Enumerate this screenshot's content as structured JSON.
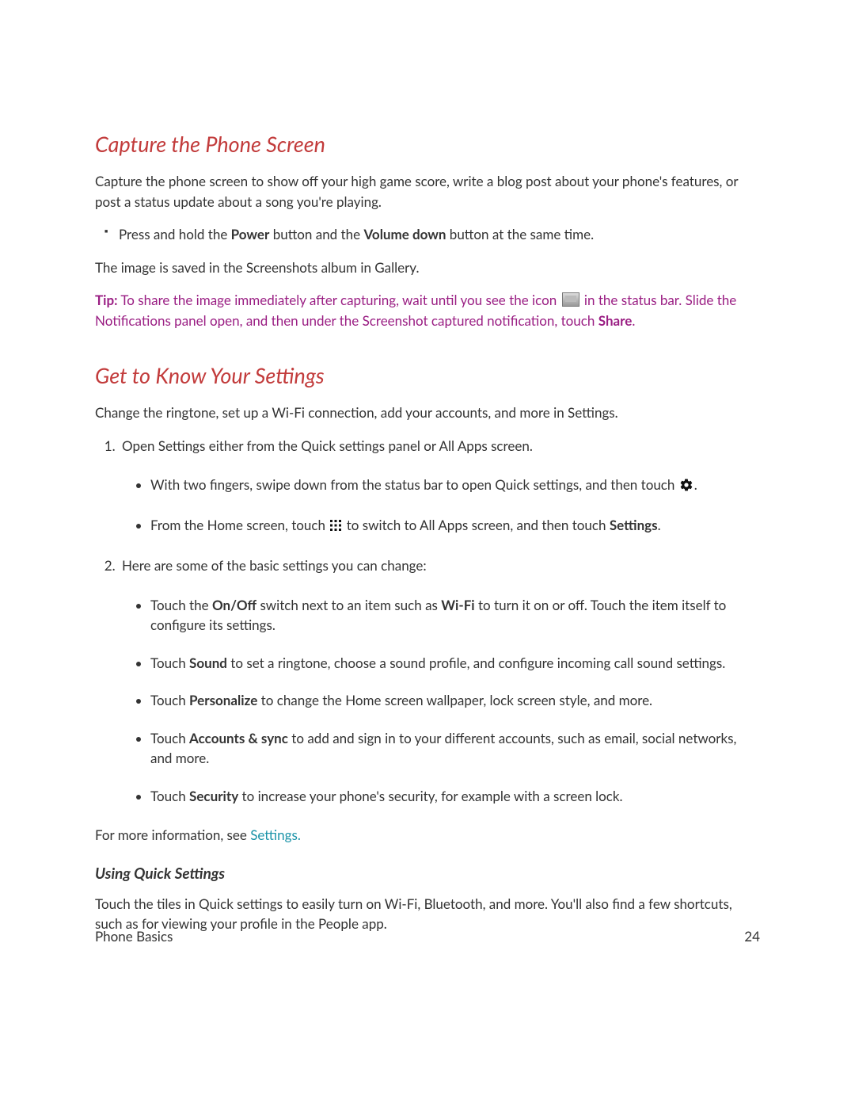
{
  "section1": {
    "title": "Capture the Phone Screen",
    "intro": "Capture the phone screen to show off your high game score, write a blog post about your phone's features, or post a status update about a song you're playing.",
    "bullet_prefix": "Press and hold the ",
    "bullet_bold1": "Power",
    "bullet_mid": " button and the ",
    "bullet_bold2": "Volume down",
    "bullet_suffix": " button at the same time.",
    "saved_note": "The image is saved in the Screenshots album in Gallery.",
    "tip_label": "Tip:",
    "tip_part1": "  To share the image  immediately after capturing, wait until you see the icon ",
    "tip_part2": " in the status bar. Slide the Notifications panel open, and then under the Screenshot captured notification, touch ",
    "tip_bold": "Share",
    "tip_end": "."
  },
  "section2": {
    "title": "Get to Know Your Settings",
    "intro": "Change the ringtone, set up a Wi-Fi connection, add your accounts, and more in Settings.",
    "step1": "Open Settings either from the Quick settings panel or All Apps screen.",
    "step1_sub1_pre": "With two fingers, swipe down from the status bar to open Quick settings, and then touch ",
    "step1_sub1_post": ".",
    "step1_sub2_pre": "From the Home screen, touch ",
    "step1_sub2_mid": " to switch to All Apps screen, and then touch ",
    "step1_sub2_bold": "Settings",
    "step1_sub2_post": ".",
    "step2": "Here are some of the basic settings you can change:",
    "s2_sub1_pre": "Touch the ",
    "s2_sub1_b1": "On/Off",
    "s2_sub1_mid": " switch next to an item such as ",
    "s2_sub1_b2": "Wi-Fi",
    "s2_sub1_post": " to turn it on or off. Touch the item itself to configure its settings.",
    "s2_sub2_pre": "Touch ",
    "s2_sub2_b": "Sound",
    "s2_sub2_post": " to set a ringtone, choose a sound profile, and configure incoming call sound settings.",
    "s2_sub3_pre": "Touch ",
    "s2_sub3_b": "Personalize",
    "s2_sub3_post": " to change the Home screen wallpaper, lock screen style, and more.",
    "s2_sub4_pre": "Touch ",
    "s2_sub4_b": "Accounts & sync",
    "s2_sub4_post": " to add and sign in to your different accounts, such as email, social networks, and more.",
    "s2_sub5_pre": "Touch ",
    "s2_sub5_b": "Security",
    "s2_sub5_post": " to increase your phone's security, for example with a screen lock.",
    "more_info_pre": "For more information, see ",
    "more_info_link": "Settings.",
    "subheading": "Using Quick Settings",
    "sub_body": "Touch the tiles in Quick settings to easily turn on Wi-Fi, Bluetooth, and more. You'll also find a few shortcuts, such as for viewing your profile in the People app."
  },
  "footer": {
    "left": "Phone Basics",
    "right": "24"
  }
}
